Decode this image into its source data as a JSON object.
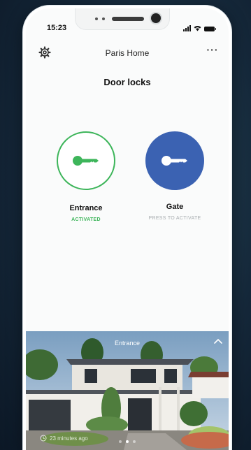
{
  "status_bar": {
    "time": "15:23"
  },
  "header": {
    "title": "Paris Home",
    "more_label": "···"
  },
  "page": {
    "title": "Door locks"
  },
  "locks": [
    {
      "name": "Entrance",
      "status": "ACTIVATED"
    },
    {
      "name": "Gate",
      "status": "PRESS TO ACTIVATE"
    }
  ],
  "camera": {
    "label": "Entrance",
    "last_updated": "23 minutes ago"
  },
  "colors": {
    "activated": "#3db55a",
    "primary": "#3b62b2",
    "inactive_text": "#a8adb0"
  },
  "icons": [
    "gear-icon",
    "more-icon",
    "key-icon",
    "chevron-up-icon",
    "clock-icon"
  ]
}
